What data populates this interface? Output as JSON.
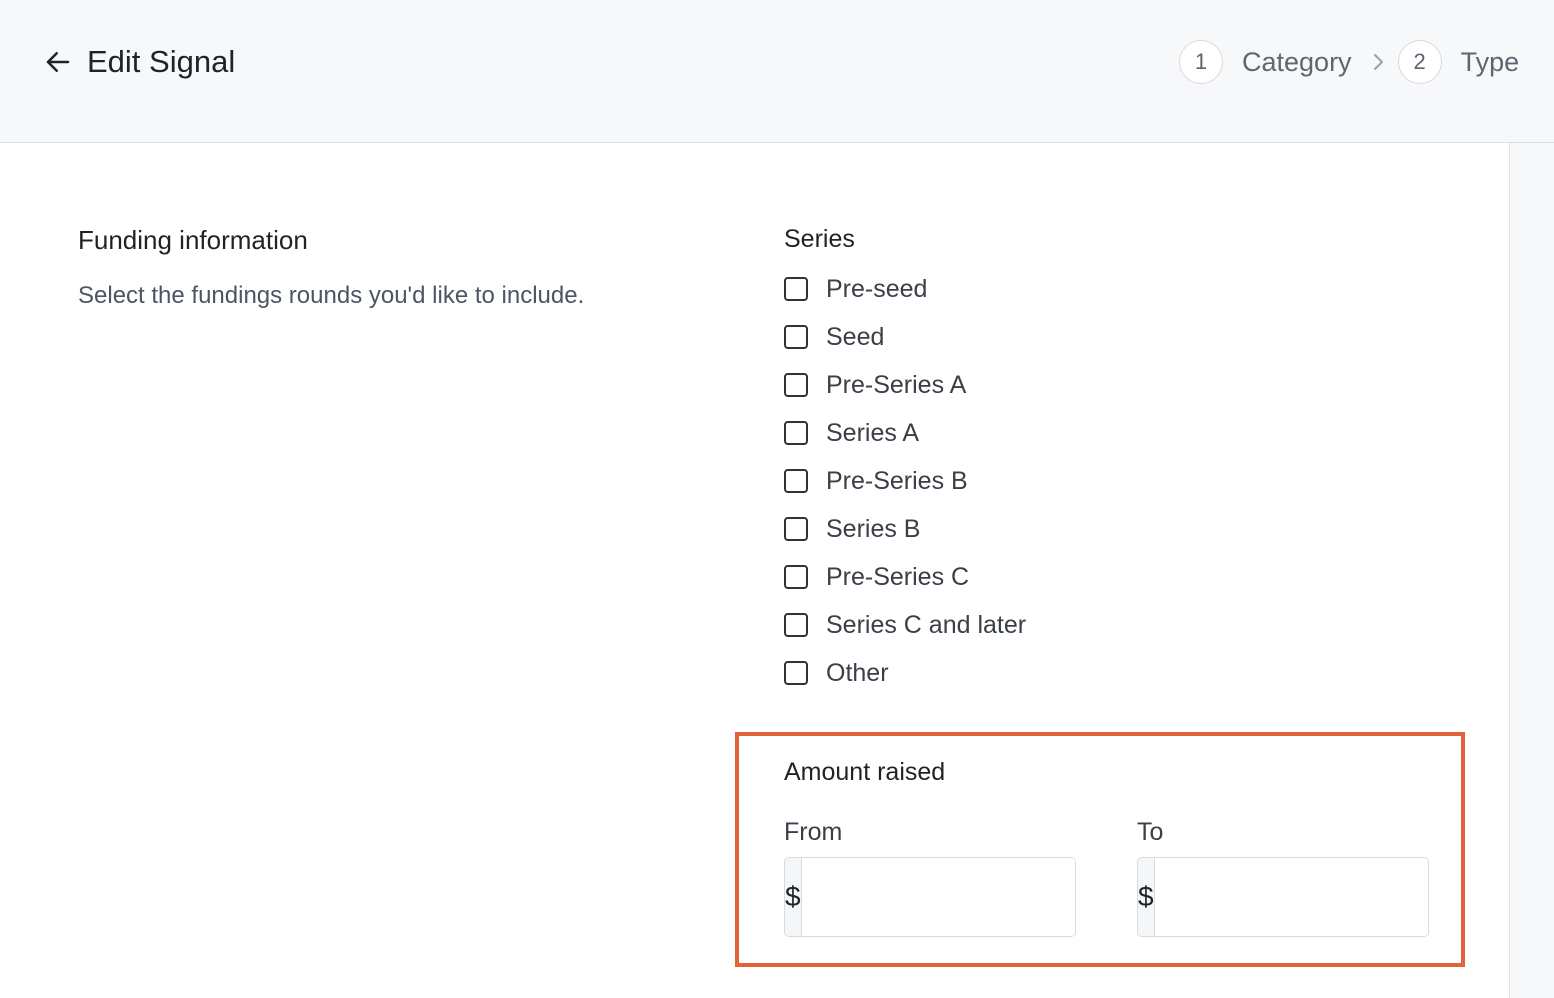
{
  "header": {
    "title": "Edit Signal",
    "back_icon": "arrow-left-icon",
    "steps": [
      {
        "number": "1",
        "label": "Category"
      },
      {
        "number": "2",
        "label": "Type"
      }
    ]
  },
  "funding": {
    "title": "Funding information",
    "description": "Select the fundings rounds you'd like to include."
  },
  "series": {
    "title": "Series",
    "options": [
      {
        "label": "Pre-seed",
        "checked": false
      },
      {
        "label": "Seed",
        "checked": false
      },
      {
        "label": "Pre-Series A",
        "checked": false
      },
      {
        "label": "Series A",
        "checked": false
      },
      {
        "label": "Pre-Series B",
        "checked": false
      },
      {
        "label": "Series B",
        "checked": false
      },
      {
        "label": "Pre-Series C",
        "checked": false
      },
      {
        "label": "Series C and later",
        "checked": false
      },
      {
        "label": "Other",
        "checked": false
      }
    ]
  },
  "amount_raised": {
    "title": "Amount raised",
    "from_label": "From",
    "to_label": "To",
    "currency_symbol": "$",
    "from_value": "",
    "to_value": ""
  },
  "colors": {
    "highlight_border": "#e2623a",
    "header_bg": "#f6f8f9"
  }
}
